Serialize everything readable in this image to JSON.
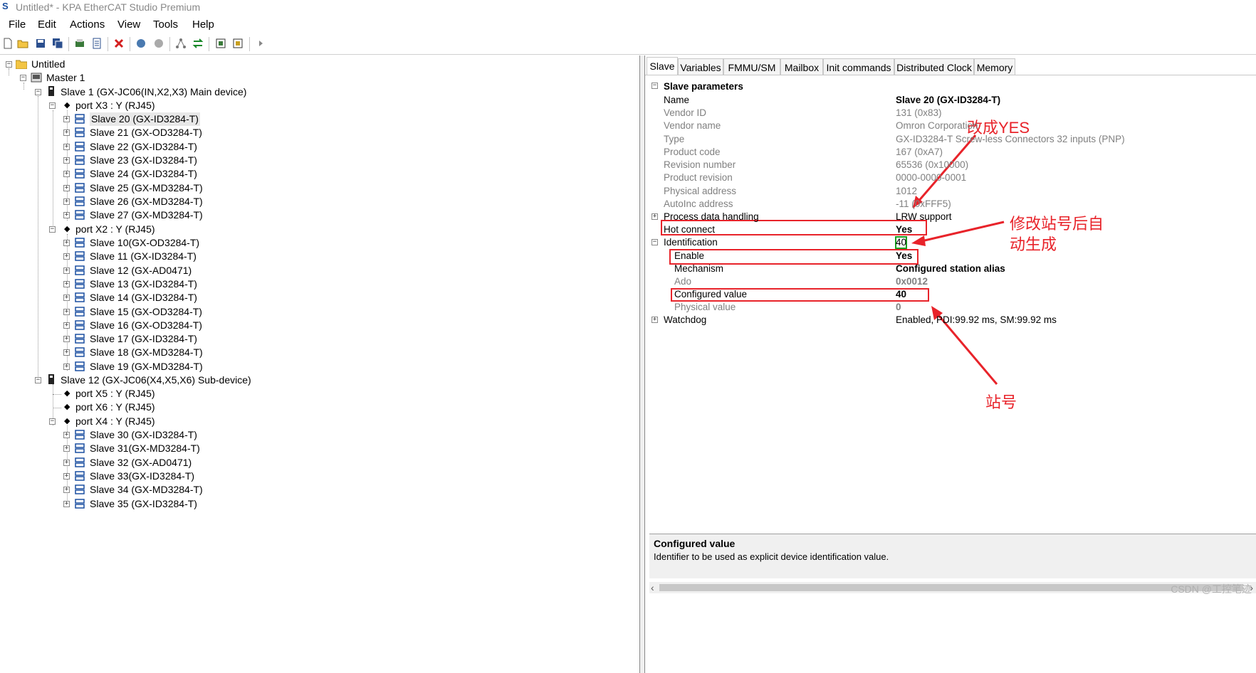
{
  "window": {
    "title": "Untitled* - KPA EtherCAT Studio Premium"
  },
  "menu": [
    "File",
    "Edit",
    "Actions",
    "View",
    "Tools",
    "Help"
  ],
  "tree": {
    "root": "Untitled",
    "master": "Master 1",
    "slave1": "Slave 1 (GX-JC06(IN,X2,X3) Main device)",
    "portX3": "port X3 : Y (RJ45)",
    "x3_children": [
      "Slave 20 (GX-ID3284-T)",
      "Slave 21 (GX-OD3284-T)",
      "Slave 22 (GX-ID3284-T)",
      "Slave 23 (GX-ID3284-T)",
      "Slave 24 (GX-ID3284-T)",
      "Slave 25 (GX-MD3284-T)",
      "Slave 26 (GX-MD3284-T)",
      "Slave 27 (GX-MD3284-T)"
    ],
    "portX2": "port X2 : Y (RJ45)",
    "x2_children": [
      "Slave 10(GX-OD3284-T)",
      "Slave 11 (GX-ID3284-T)",
      "Slave 12 (GX-AD0471)",
      "Slave 13 (GX-ID3284-T)",
      "Slave 14 (GX-ID3284-T)",
      "Slave 15 (GX-OD3284-T)",
      "Slave 16 (GX-OD3284-T)",
      "Slave 17 (GX-ID3284-T)",
      "Slave 18 (GX-MD3284-T)",
      "Slave 19 (GX-MD3284-T)"
    ],
    "slave12": "Slave 12 (GX-JC06(X4,X5,X6) Sub-device)",
    "portX5": "port X5 : Y (RJ45)",
    "portX6": "port X6 : Y (RJ45)",
    "portX4": "port X4 : Y (RJ45)",
    "x4_children": [
      "Slave 30 (GX-ID3284-T)",
      "Slave 31(GX-MD3284-T)",
      "Slave 32 (GX-AD0471)",
      "Slave 33(GX-ID3284-T)",
      "Slave 34 (GX-MD3284-T)",
      "Slave 35 (GX-ID3284-T)"
    ]
  },
  "tabs": [
    "Slave",
    "Variables",
    "FMMU/SM",
    "Mailbox",
    "Init commands",
    "Distributed Clock",
    "Memory"
  ],
  "params": {
    "section": "Slave parameters",
    "rows": [
      {
        "name": "Name",
        "value": "Slave 20 (GX-ID3284-T)"
      },
      {
        "name": "Vendor ID",
        "value": "131 (0x83)"
      },
      {
        "name": "Vendor name",
        "value": "Omron Corporation"
      },
      {
        "name": "Type",
        "value": "GX-ID3284-T Screw-less Connectors 32 inputs (PNP)"
      },
      {
        "name": "Product code",
        "value": "167 (0xA7)"
      },
      {
        "name": "Revision number",
        "value": "65536 (0x10000)"
      },
      {
        "name": "Product revision",
        "value": "0000-0000-0001"
      },
      {
        "name": "Physical address",
        "value": "1012"
      },
      {
        "name": "AutoInc address",
        "value": "-11 (0xFFF5)"
      },
      {
        "name": "Process data handling",
        "value": "LRW support"
      },
      {
        "name": "Hot connect",
        "value": "Yes"
      },
      {
        "name": "Identification",
        "value": "40"
      },
      {
        "name": "Enable",
        "value": "Yes"
      },
      {
        "name": "Mechanism",
        "value": "Configured station alias"
      },
      {
        "name": "Ado",
        "value": "0x0012"
      },
      {
        "name": "Configured value",
        "value": "40"
      },
      {
        "name": "Physical value",
        "value": "0"
      },
      {
        "name": "Watchdog",
        "value": "Enabled, PDI:99.92 ms, SM:99.92 ms"
      }
    ]
  },
  "help": {
    "title": "Configured value",
    "text": "Identifier to be used as explicit device identification value."
  },
  "annotations": {
    "change_yes": "改成YES",
    "auto_gen": "修改站号后自",
    "auto_gen2": "动生成",
    "station": "站号"
  },
  "watermark": "CSDN @工控笔迹"
}
